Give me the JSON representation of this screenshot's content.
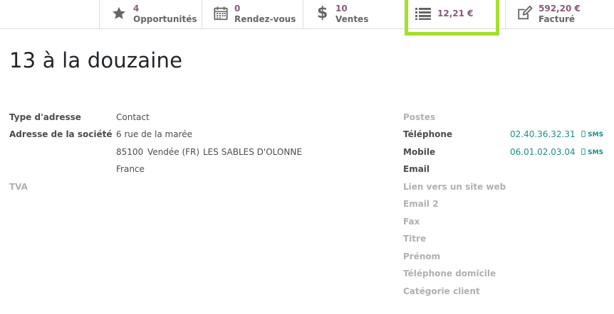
{
  "stat_buttons": {
    "opportunities": {
      "value": "4",
      "label": "Opportunités"
    },
    "meetings": {
      "value": "0",
      "label": "Rendez-vous"
    },
    "sales": {
      "value": "10",
      "label": "Ventes"
    },
    "amount": {
      "value": "12,21 €"
    },
    "invoiced": {
      "value": "592,20 €",
      "label": "Facturé"
    }
  },
  "record": {
    "title": "13 à la douzaine"
  },
  "left_fields": {
    "address_type_label": "Type d'adresse",
    "address_type_value": "Contact",
    "company_address_label": "Adresse de la société",
    "street": "6 rue de la marée",
    "zip": "85100",
    "state": "Vendée (FR)",
    "city": "LES SABLES D'OLONNE",
    "country": "France",
    "vat_label": "TVA"
  },
  "right_fields": {
    "positions_label": "Postes",
    "phone_label": "Téléphone",
    "phone_value": "02.40.36.32.31",
    "mobile_label": "Mobile",
    "mobile_value": "06.01.02.03.04",
    "sms_label": "SMS",
    "email_label": "Email",
    "website_label": "Lien vers un site web",
    "email2_label": "Email 2",
    "fax_label": "Fax",
    "title_label": "Titre",
    "firstname_label": "Prénom",
    "home_phone_label": "Téléphone domicile",
    "customer_category_label": "Catégorie client"
  },
  "colors": {
    "accent": "#875a7b",
    "link": "#1e8c8a",
    "highlight": "#a4e02b"
  },
  "icons": [
    "star-icon",
    "calendar-icon",
    "dollar-icon",
    "list-icon",
    "edit-icon",
    "mobile-icon"
  ]
}
